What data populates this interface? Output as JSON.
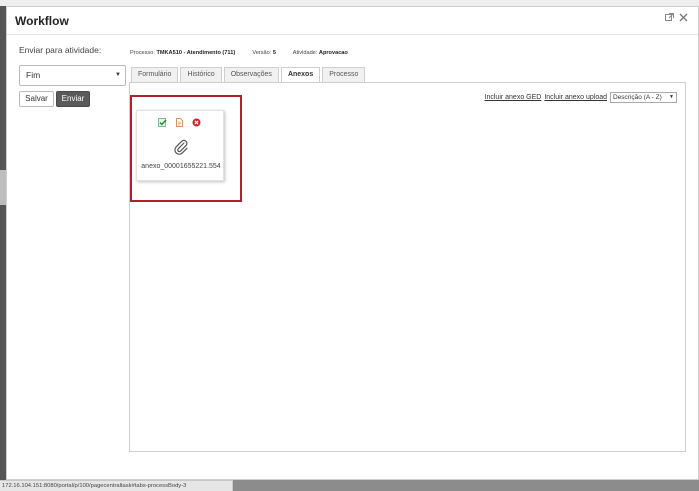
{
  "window": {
    "title": "Workflow"
  },
  "titlebar_icons": [
    "external-link-icon",
    "close-icon"
  ],
  "left": {
    "label": "Enviar para atividade:",
    "select_value": "Fim",
    "save_label": "Salvar",
    "send_label": "Enviar"
  },
  "info": {
    "processo_label": "Processo:",
    "processo_value": "TMKA510 - Atendimento (711)",
    "versao_label": "Versão:",
    "versao_value": "5",
    "atividade_label": "Atividade:",
    "atividade_value": "Aprovacao"
  },
  "tabs": [
    {
      "label": "Formulário",
      "active": false
    },
    {
      "label": "Histórico",
      "active": false
    },
    {
      "label": "Observações",
      "active": false
    },
    {
      "label": "Anexos",
      "active": true
    },
    {
      "label": "Processo",
      "active": false
    }
  ],
  "panel": {
    "link_ged": "Incluir anexo GED",
    "link_upload": "Incluir anexo upload",
    "sort_value": "Descrição (A - Z)"
  },
  "attachment": {
    "name": "anexo_00001655221.554",
    "actions": [
      "check-icon",
      "document-icon",
      "delete-icon"
    ]
  },
  "status_bar": {
    "url": "172.16.104.151:8080/portal/p/100/pagecentraltask#tabs-processBody-3"
  },
  "colors": {
    "highlight": "#b21f2d",
    "send_button": "#5a5a5a"
  }
}
